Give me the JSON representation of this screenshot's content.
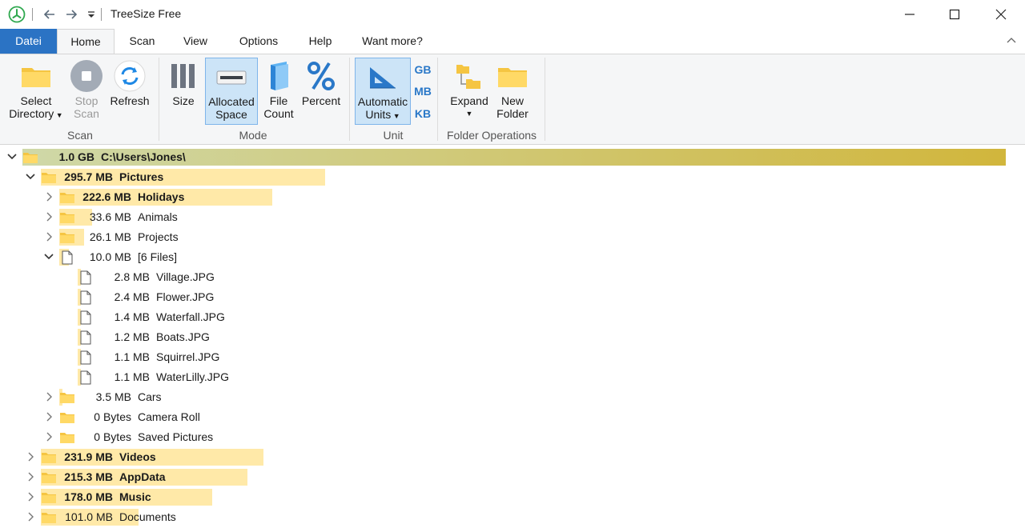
{
  "window": {
    "title": "TreeSize Free"
  },
  "tabs": {
    "file": "Datei",
    "home": "Home",
    "scan": "Scan",
    "view": "View",
    "options": "Options",
    "help": "Help",
    "want_more": "Want more?"
  },
  "ribbon": {
    "select_directory": [
      "Select",
      "Directory"
    ],
    "stop_scan": [
      "Stop",
      "Scan"
    ],
    "refresh": "Refresh",
    "size": "Size",
    "allocated_space": [
      "Allocated",
      "Space"
    ],
    "file_count": [
      "File",
      "Count"
    ],
    "percent": "Percent",
    "automatic_units": [
      "Automatic",
      "Units"
    ],
    "gb": "GB",
    "mb": "MB",
    "kb": "KB",
    "expand": "Expand",
    "new_folder": [
      "New",
      "Folder"
    ],
    "groups": {
      "scan": "Scan",
      "mode": "Mode",
      "unit": "Unit",
      "folder_ops": "Folder Operations"
    }
  },
  "colors": {
    "accent": "#2b73c4",
    "bar": "#ffe9a8",
    "root_bar_start": "#cfd8a8",
    "root_bar_end": "#d1b63c",
    "selected_button": "#cce4f7"
  },
  "tree": [
    {
      "size": "1.0 GB",
      "name": "C:\\Users\\Jones\\",
      "icon": "folder-icon",
      "expander": "expanded",
      "bold": true,
      "share": 1.0
    },
    {
      "size": "295.7 MB",
      "name": "Pictures",
      "icon": "folder-icon",
      "expander": "expanded",
      "bold": true,
      "share": 0.289
    },
    {
      "size": "222.6 MB",
      "name": "Holidays",
      "icon": "folder-icon",
      "expander": "collapsed",
      "bold": true,
      "share": 0.217
    },
    {
      "size": "33.6 MB",
      "name": "Animals",
      "icon": "folder-icon",
      "expander": "collapsed",
      "bold": false,
      "share": 0.033
    },
    {
      "size": "26.1 MB",
      "name": "Projects",
      "icon": "folder-icon",
      "expander": "collapsed",
      "bold": false,
      "share": 0.025
    },
    {
      "size": "10.0 MB",
      "name": "[6 Files]",
      "icon": "file-icon",
      "expander": "expanded",
      "bold": false,
      "share": 0.01
    },
    {
      "size": "2.8 MB",
      "name": "Village.JPG",
      "icon": "file-icon",
      "expander": "none",
      "bold": false,
      "share": 0.003
    },
    {
      "size": "2.4 MB",
      "name": "Flower.JPG",
      "icon": "file-icon",
      "expander": "none",
      "bold": false,
      "share": 0.002
    },
    {
      "size": "1.4 MB",
      "name": "Waterfall.JPG",
      "icon": "file-icon",
      "expander": "none",
      "bold": false,
      "share": 0.001
    },
    {
      "size": "1.2 MB",
      "name": "Boats.JPG",
      "icon": "file-icon",
      "expander": "none",
      "bold": false,
      "share": 0.001
    },
    {
      "size": "1.1 MB",
      "name": "Squirrel.JPG",
      "icon": "file-icon",
      "expander": "none",
      "bold": false,
      "share": 0.001
    },
    {
      "size": "1.1 MB",
      "name": "WaterLilly.JPG",
      "icon": "file-icon",
      "expander": "none",
      "bold": false,
      "share": 0.001
    },
    {
      "size": "3.5 MB",
      "name": "Cars",
      "icon": "folder-icon",
      "expander": "collapsed",
      "bold": false,
      "share": 0.003
    },
    {
      "size": "0 Bytes",
      "name": "Camera Roll",
      "icon": "folder-icon",
      "expander": "collapsed",
      "bold": false,
      "share": 0
    },
    {
      "size": "0 Bytes",
      "name": "Saved Pictures",
      "icon": "folder-icon",
      "expander": "collapsed",
      "bold": false,
      "share": 0
    },
    {
      "size": "231.9 MB",
      "name": "Videos",
      "icon": "folder-icon",
      "expander": "collapsed",
      "bold": true,
      "share": 0.226
    },
    {
      "size": "215.3 MB",
      "name": "AppData",
      "icon": "folder-icon",
      "expander": "collapsed",
      "bold": true,
      "share": 0.21
    },
    {
      "size": "178.0 MB",
      "name": "Music",
      "icon": "folder-icon",
      "expander": "collapsed",
      "bold": true,
      "share": 0.174
    },
    {
      "size": "101.0 MB",
      "name": "Documents",
      "icon": "folder-icon",
      "expander": "collapsed",
      "bold": false,
      "share": 0.099
    }
  ]
}
